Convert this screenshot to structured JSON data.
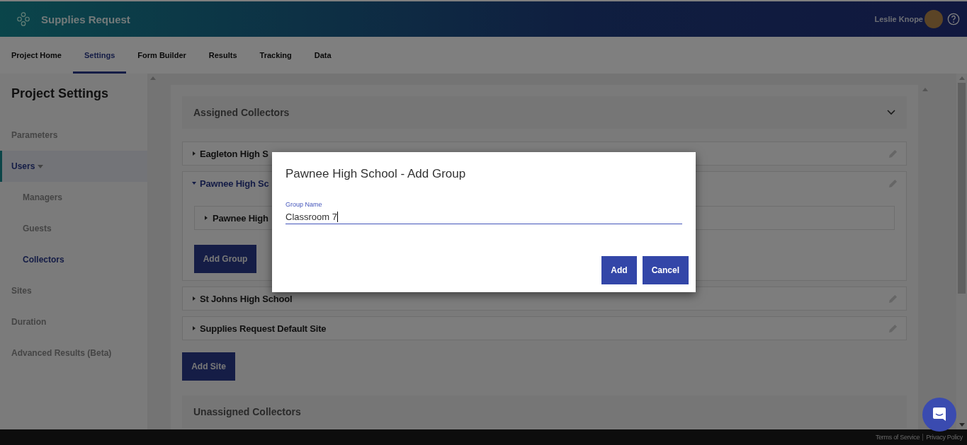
{
  "header": {
    "title": "Supplies Request",
    "user": "Leslie Knope"
  },
  "tabs": [
    {
      "label": "Project Home",
      "selected": false
    },
    {
      "label": "Settings",
      "selected": true
    },
    {
      "label": "Form Builder",
      "selected": false
    },
    {
      "label": "Results",
      "selected": false
    },
    {
      "label": "Tracking",
      "selected": false
    },
    {
      "label": "Data",
      "selected": false
    }
  ],
  "sidebar": {
    "title": "Project Settings",
    "items": [
      {
        "label": "Parameters",
        "selected": false
      },
      {
        "label": "Users",
        "selected": true,
        "expanded": true,
        "children": [
          {
            "label": "Managers",
            "selected": false
          },
          {
            "label": "Guests",
            "selected": false
          },
          {
            "label": "Collectors",
            "selected": true
          }
        ]
      },
      {
        "label": "Sites",
        "selected": false
      },
      {
        "label": "Duration",
        "selected": false
      },
      {
        "label": "Advanced Results (Beta)",
        "selected": false
      }
    ]
  },
  "assigned": {
    "title": "Assigned Collectors",
    "expanded": true,
    "sites": [
      {
        "name": "Eagleton High S",
        "expanded": false
      },
      {
        "name": "Pawnee High Sc",
        "expanded": true,
        "groups": [
          {
            "name": "Pawnee High",
            "expanded": false
          }
        ],
        "add_button": "Add Group"
      },
      {
        "name": "St Johns High School",
        "expanded": false
      },
      {
        "name": "Supplies Request Default Site",
        "expanded": false
      }
    ],
    "add_button": "Add Site"
  },
  "unassigned": {
    "title": "Unassigned Collectors"
  },
  "dialog": {
    "title": "Pawnee High School - Add Group",
    "field": {
      "label": "Group Name",
      "value": "Classroom 7"
    },
    "buttons": [
      "Add",
      "Cancel"
    ]
  },
  "footer": {
    "links": [
      "Terms of Service",
      "Privacy Policy"
    ]
  }
}
